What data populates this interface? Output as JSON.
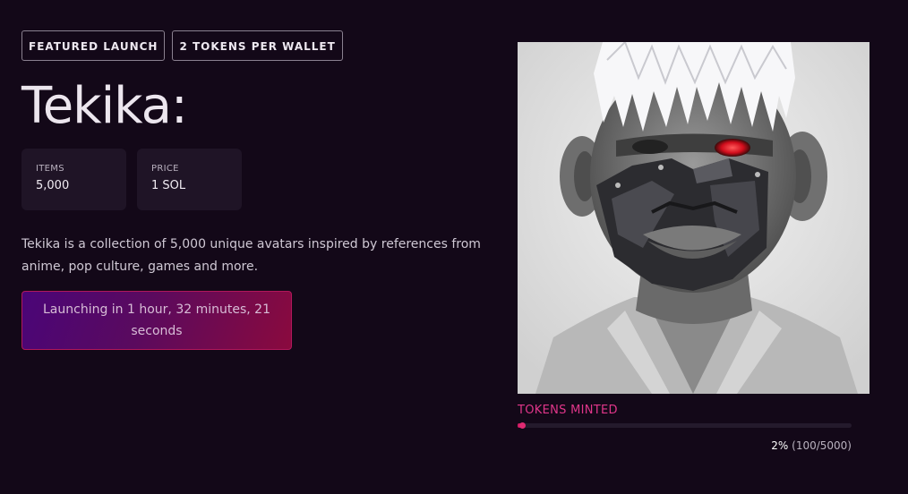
{
  "badges": {
    "featured": "FEATURED LAUNCH",
    "wallet_limit": "2 TOKENS PER WALLET"
  },
  "collection": {
    "title": "Tekika:",
    "description": "Tekika is a collection of 5,000 unique avatars inspired by references from anime, pop culture, games and more."
  },
  "stats": {
    "items": {
      "label": "ITEMS",
      "value": "5,000"
    },
    "price": {
      "label": "PRICE",
      "value": "1 SOL"
    }
  },
  "launch": {
    "label": "Launching in 1 hour, 32 minutes, 21 seconds"
  },
  "minting": {
    "label": "TOKENS MINTED",
    "percent_text": "2%",
    "count_text": "(100/5000)",
    "minted": 100,
    "total": 5000,
    "fraction": 0.02
  },
  "colors": {
    "background": "#130818",
    "card": "#1f1426",
    "accent_pink": "#e0368a",
    "launch_gradient_start": "#4a0578",
    "launch_gradient_end": "#8a0a3e"
  },
  "image": {
    "subject": "grayscale-portrait-white-hair-masked-avatar"
  }
}
